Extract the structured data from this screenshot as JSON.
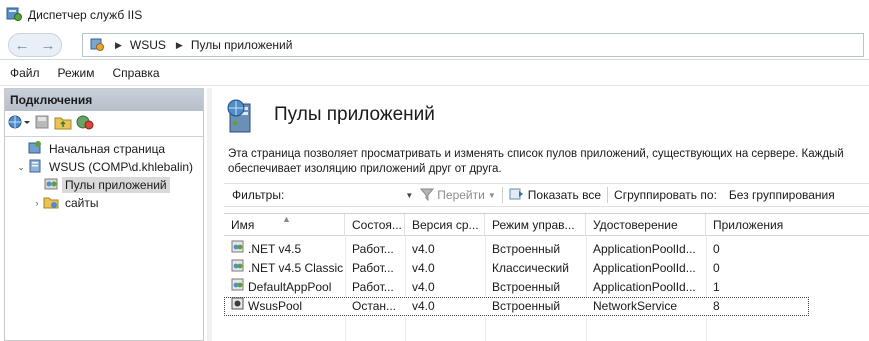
{
  "window": {
    "title": "Диспетчер служб IIS"
  },
  "address": {
    "crumbs": [
      "WSUS",
      "Пулы приложений"
    ]
  },
  "menu": [
    "Файл",
    "Режим",
    "Справка"
  ],
  "connections": {
    "header": "Подключения",
    "tree": [
      {
        "label": "Начальная страница",
        "expander": "",
        "icon": "home-icon"
      },
      {
        "label": "WSUS (COMP\\d.khlebalin)",
        "expander": "⌄",
        "icon": "server-icon"
      },
      {
        "label": "Пулы приложений",
        "expander": "",
        "icon": "app-pool-icon",
        "selected": true
      },
      {
        "label": "сайты",
        "expander": "›",
        "icon": "sites-folder-icon"
      }
    ]
  },
  "page": {
    "title": "Пулы приложений",
    "description_line1": "Эта страница позволяет просматривать и изменять список пулов приложений, существующих на сервере. Каждый",
    "description_line2": "обеспечивает изоляцию приложений друг от друга."
  },
  "filterbar": {
    "filters_label": "Фильтры:",
    "filter_value": "",
    "go_label": "Перейти",
    "show_all_label": "Показать все",
    "group_label": "Сгруппировать по:",
    "group_value": "Без группирования"
  },
  "grid": {
    "columns": [
      "Имя",
      "Состоя...",
      "Версия ср...",
      "Режим управ...",
      "Удостоверение",
      "Приложения"
    ],
    "rows": [
      {
        "name": ".NET v4.5",
        "state": "Работ...",
        "version": "v4.0",
        "mode": "Встроенный",
        "identity": "ApplicationPoolId...",
        "apps": "0",
        "status": "running"
      },
      {
        "name": ".NET v4.5 Classic",
        "state": "Работ...",
        "version": "v4.0",
        "mode": "Классический",
        "identity": "ApplicationPoolId...",
        "apps": "0",
        "status": "running"
      },
      {
        "name": "DefaultAppPool",
        "state": "Работ...",
        "version": "v4.0",
        "mode": "Встроенный",
        "identity": "ApplicationPoolId...",
        "apps": "1",
        "status": "running"
      },
      {
        "name": "WsusPool",
        "state": "Остан...",
        "version": "v4.0",
        "mode": "Встроенный",
        "identity": "NetworkService",
        "apps": "8",
        "status": "stopped",
        "selected": true
      }
    ]
  },
  "colors": {
    "accent": "#2a7fc9",
    "selection": "#d9d9d9"
  }
}
